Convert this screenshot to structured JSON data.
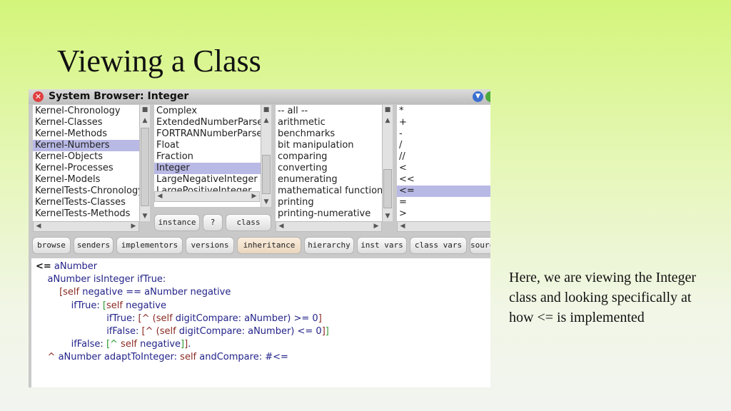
{
  "slide": {
    "title": "Viewing a Class",
    "caption": "Here, we are viewing the Integer class and looking specifically at how <= is implemented"
  },
  "window": {
    "title": "System Browser: Integer",
    "close_icon": "close-icon",
    "menu_icon": "menu-down-icon",
    "collapse_icon": "collapse-icon"
  },
  "packages": {
    "items": [
      "Kernel-Chronology",
      "Kernel-Classes",
      "Kernel-Methods",
      "Kernel-Numbers",
      "Kernel-Objects",
      "Kernel-Processes",
      "Kernel-Models",
      "KernelTests-Chronology",
      "KernelTests-Classes",
      "KernelTests-Methods"
    ],
    "selected": 3
  },
  "classes": {
    "items": [
      "Complex",
      "ExtendedNumberParser",
      "FORTRANNumberParser",
      "Float",
      "Fraction",
      "Integer",
      "LargeNegativeInteger",
      "LargePositiveInteger"
    ],
    "selected": 5
  },
  "class_toggle": {
    "instance": "instance",
    "help": "?",
    "class": "class"
  },
  "categories": {
    "items": [
      "-- all --",
      "arithmetic",
      "benchmarks",
      "bit manipulation",
      "comparing",
      "converting",
      "enumerating",
      "mathematical functions",
      "printing",
      "printing-numerative"
    ]
  },
  "methods": {
    "items": [
      "*",
      "+",
      "-",
      "/",
      "//",
      "<",
      "<<",
      "<=",
      "=",
      ">"
    ],
    "selected": 7
  },
  "toolbar": {
    "buttons": [
      "browse",
      "senders",
      "implementors",
      "versions",
      "inheritance",
      "hierarchy",
      "inst vars",
      "class vars",
      "source"
    ],
    "active": 4
  },
  "code": {
    "lines": [
      {
        "indent": "",
        "tokens": [
          [
            "sel",
            "<="
          ],
          [
            "kw",
            " aNumber"
          ]
        ]
      },
      {
        "indent": "    ",
        "tokens": [
          [
            "kw",
            "aNumber isInteger ifTrue:"
          ]
        ]
      },
      {
        "indent": "        ",
        "tokens": [
          [
            "br1",
            "["
          ],
          [
            "self",
            "self"
          ],
          [
            "kw",
            " negative == aNumber negative"
          ]
        ]
      },
      {
        "indent": "            ",
        "tokens": [
          [
            "kw",
            "ifTrue: "
          ],
          [
            "br2",
            "["
          ],
          [
            "self",
            "self"
          ],
          [
            "kw",
            " negative"
          ]
        ]
      },
      {
        "indent": "                        ",
        "tokens": [
          [
            "kw",
            "ifTrue: "
          ],
          [
            "br1",
            "[^ ("
          ],
          [
            "self",
            "self"
          ],
          [
            "kw",
            " digitCompare: aNumber) >= 0"
          ],
          [
            "br1",
            "]"
          ]
        ]
      },
      {
        "indent": "                        ",
        "tokens": [
          [
            "kw",
            "ifFalse: "
          ],
          [
            "br1",
            "[^ ("
          ],
          [
            "self",
            "self"
          ],
          [
            "kw",
            " digitCompare: aNumber) <= 0"
          ],
          [
            "br1",
            "]"
          ],
          [
            "br2",
            "]"
          ]
        ]
      },
      {
        "indent": "            ",
        "tokens": [
          [
            "kw",
            "ifFalse: "
          ],
          [
            "br2",
            "[^ "
          ],
          [
            "self",
            "self"
          ],
          [
            "kw",
            " negative"
          ],
          [
            "br2",
            "]"
          ],
          [
            "br1",
            "]"
          ],
          [
            "kw",
            "."
          ]
        ]
      },
      {
        "indent": "    ",
        "tokens": [
          [
            "br1",
            "^"
          ],
          [
            "kw",
            " aNumber adaptToInteger: "
          ],
          [
            "self",
            "self"
          ],
          [
            "kw",
            " andCompare: #<="
          ]
        ]
      }
    ]
  }
}
